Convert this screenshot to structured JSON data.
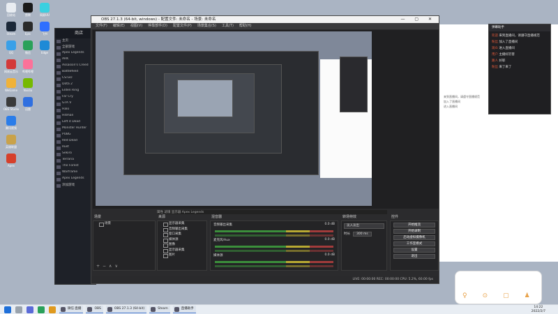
{
  "obs_window": {
    "title": "OBS 27.1.3 (64-bit, windows) - 配置文件: 未命名 - 场景: 未命名",
    "menu": [
      "文件(F)",
      "编辑(E)",
      "视图(V)",
      "停靠部件(D)",
      "配置文件(P)",
      "场景集合(S)",
      "工具(T)",
      "帮助(H)"
    ],
    "controls": "— ▢ ✕"
  },
  "docks": {
    "scenes_title": "场景",
    "scene_items": [
      "场景"
    ],
    "sources_title": "来源",
    "source_items": [
      "显示器采集",
      "音频输出采集",
      "窗口采集",
      "媒体源",
      "图像",
      "显示器采集",
      "图片"
    ],
    "mixer_title": "混音器",
    "mixer_items": [
      "音频输出采集",
      "麦克风/Aux",
      "媒体源"
    ],
    "mixer_db": [
      "0.0 dB",
      "0.0 dB",
      "0.0 dB"
    ],
    "transitions_title": "转场特效",
    "transition_value": "淡入淡出",
    "duration_label": "时长",
    "duration_value": "300 ms",
    "controls_title": "控件",
    "controls_buttons": [
      "开始推流",
      "开始录制",
      "启动虚拟摄像机",
      "工作室模式",
      "设置",
      "退出"
    ],
    "source_bar": "属性   滤镜   显示器 Apex Legends"
  },
  "status_bar": "LIVE: 00:00:00   REC: 00:00:00   CPU: 5.2%, 60.00 fps",
  "steam": {
    "header": "商店",
    "items": [
      "主页",
      "全部游戏",
      "Apex Legends",
      "ARK",
      "Assassin's Creed",
      "Battlefield",
      "CS:GO",
      "Dota 2",
      "Elden Ring",
      "Far Cry",
      "GTA V",
      "Halo",
      "Hitman",
      "Left 4 Dead",
      "Monster Hunter",
      "PUBG",
      "Red Dead",
      "Rust",
      "Sekiro",
      "Terraria",
      "The Forest",
      "Warframe",
      "Apex Legends",
      "添加游戏"
    ]
  },
  "chat": {
    "lines": [
      {
        "name": "欢迎",
        "text": "来到直播间，请遵守直播规范"
      },
      {
        "name": "粉丝",
        "text": "加入了直播间"
      },
      {
        "name": "观众",
        "text": "进入直播间"
      },
      {
        "name": "用户",
        "text": "主播好厉害"
      },
      {
        "name": "路人",
        "text": "好耶"
      },
      {
        "name": "粉丝",
        "text": "来了来了"
      }
    ]
  },
  "desktop_icons": [
    "回收站",
    "Steam",
    "QQ",
    "网易云音乐",
    "WeGame",
    "OBS Studio",
    "腾讯视频",
    "英雄联盟",
    "Apex",
    "剪映",
    "Epic",
    "微信",
    "哔哩哔哩",
    "Nvidia",
    "迅雷",
    "网易UU",
    "飞书",
    "Edge"
  ],
  "taskbar": {
    "apps": [
      "微信·直播",
      "OBS",
      "OBS 27.1.3 (64-bit)",
      "Steam",
      "直播助手"
    ],
    "time": "14:22",
    "date": "2022/2/7"
  },
  "colors": {
    "desktop": "#aab4c3",
    "obs_bg": "#2b2b2d",
    "accent": "#4a7bd0",
    "chat_name": "#e45a3a"
  }
}
